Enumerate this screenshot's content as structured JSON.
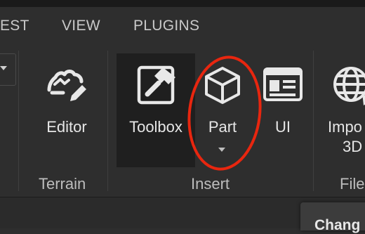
{
  "tabs": [
    {
      "label": "EST"
    },
    {
      "label": "VIEW"
    },
    {
      "label": "PLUGINS"
    }
  ],
  "tools": {
    "editor": {
      "label": "Editor",
      "icon": "terrain-editor-icon"
    },
    "toolbox": {
      "label": "Toolbox",
      "icon": "toolbox-hammer-icon"
    },
    "part": {
      "label": "Part",
      "icon": "cube-icon"
    },
    "ui": {
      "label": "UI",
      "icon": "ui-card-icon"
    },
    "import3d": {
      "label_line1": "Impo",
      "label_line2": "3D",
      "icon": "globe-icon"
    }
  },
  "groups": {
    "terrain": "Terrain",
    "insert": "Insert",
    "file": "File"
  },
  "panel": {
    "title": "Chang"
  },
  "colors": {
    "background": "#2e2e2e",
    "toolbox_active_bg": "#1f1f1f",
    "annotation_circle": "#e8260f"
  }
}
